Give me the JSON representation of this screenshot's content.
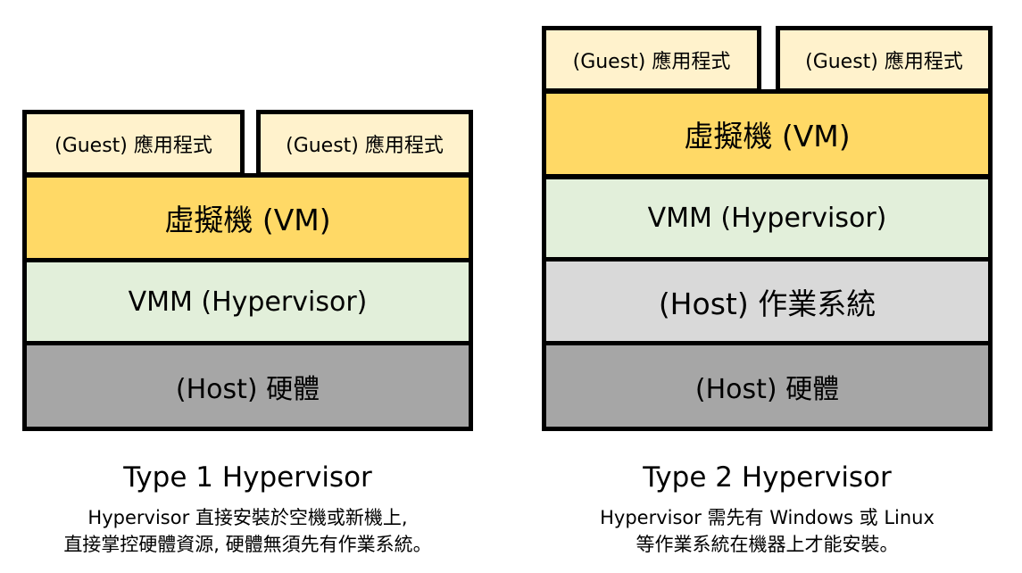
{
  "type1": {
    "app_left": "(Guest) 應用程式",
    "app_right": "(Guest) 應用程式",
    "vm": "虛擬機 (VM)",
    "vmm": "VMM (Hypervisor)",
    "hardware": "(Host) 硬體",
    "title": "Type 1 Hypervisor",
    "desc_line1": "Hypervisor 直接安裝於空機或新機上,",
    "desc_line2": "直接掌控硬體資源, 硬體無須先有作業系統。"
  },
  "type2": {
    "app_left": "(Guest) 應用程式",
    "app_right": "(Guest) 應用程式",
    "vm": "虛擬機 (VM)",
    "vmm": "VMM (Hypervisor)",
    "os": "(Host) 作業系統",
    "hardware": "(Host) 硬體",
    "title": "Type 2 Hypervisor",
    "desc_line1": "Hypervisor 需先有 Windows 或 Linux",
    "desc_line2": "等作業系統在機器上才能安裝。"
  },
  "colors": {
    "app": "#fff2cc",
    "vm": "#ffd966",
    "vmm": "#e2efda",
    "os": "#d9d9d9",
    "hardware": "#a6a6a6",
    "border": "#000000"
  }
}
